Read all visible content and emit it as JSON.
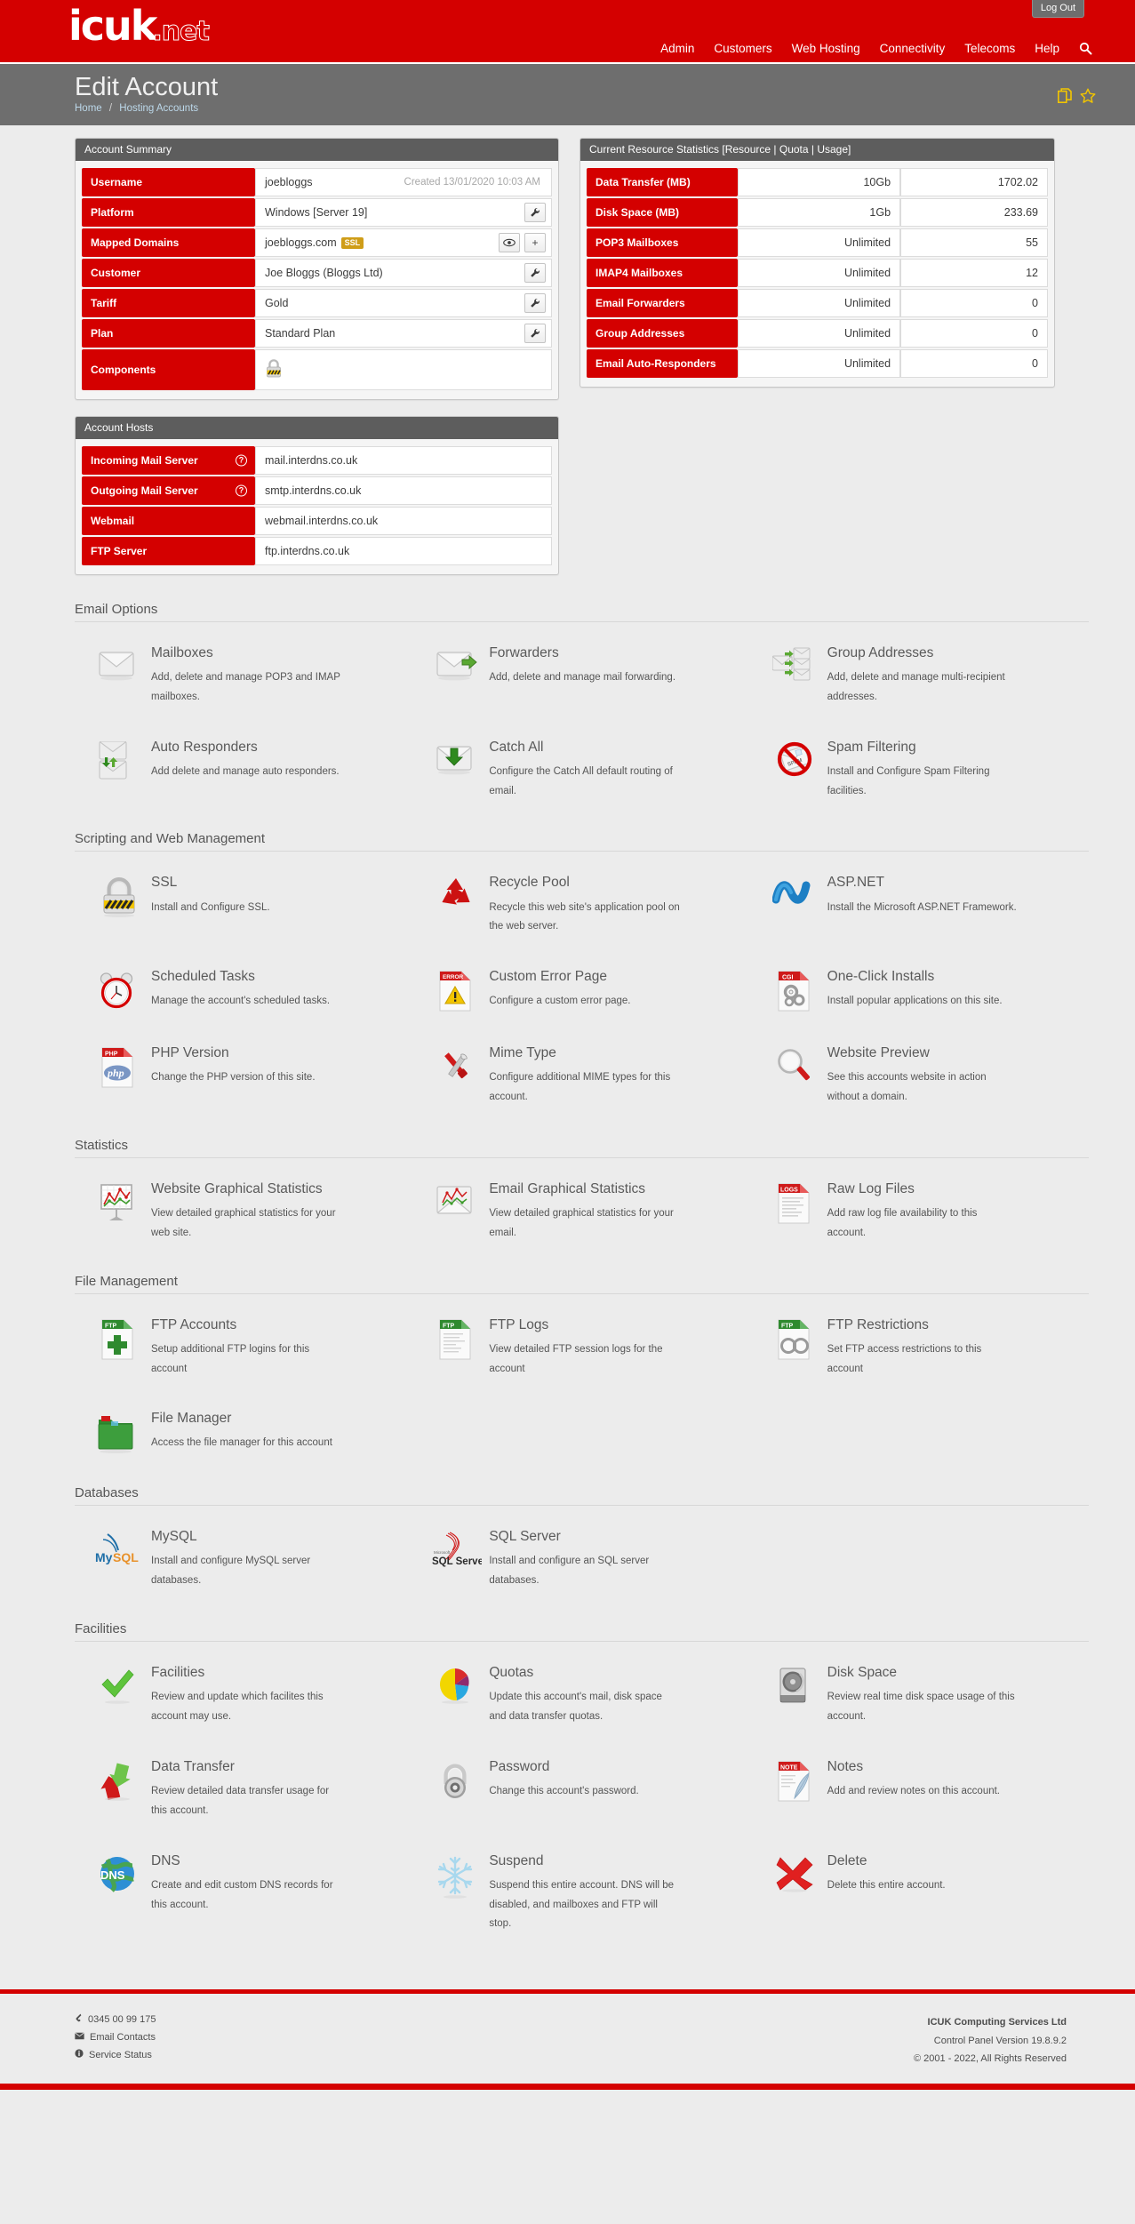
{
  "header": {
    "logo_main": "icuk",
    "logo_suffix": ".net",
    "logout_label": "Log Out",
    "nav": [
      {
        "label": "Admin"
      },
      {
        "label": "Customers"
      },
      {
        "label": "Web Hosting"
      },
      {
        "label": "Connectivity"
      },
      {
        "label": "Telecoms"
      },
      {
        "label": "Help"
      }
    ],
    "search_icon": "search-icon"
  },
  "title_band": {
    "page_title": "Edit Account",
    "breadcrumb": [
      {
        "label": "Home"
      },
      {
        "label": "Hosting Accounts"
      }
    ],
    "separator": "/",
    "actions": [
      {
        "icon": "copy-icon"
      },
      {
        "icon": "star-icon"
      }
    ]
  },
  "account_summary": {
    "panel_title": "Account Summary",
    "rows": [
      {
        "key": "Username",
        "value": "joebloggs",
        "created": "Created 13/01/2020 10:03 AM",
        "buttons": []
      },
      {
        "key": "Platform",
        "value": "Windows [Server 19]",
        "buttons": [
          "wrench"
        ]
      },
      {
        "key": "Mapped Domains",
        "value": "joebloggs.com",
        "badge": "SSL",
        "buttons": [
          "eye",
          "plus"
        ]
      },
      {
        "key": "Customer",
        "value": "Joe Bloggs (Bloggs Ltd)",
        "buttons": [
          "wrench"
        ]
      },
      {
        "key": "Tariff",
        "value": "Gold",
        "buttons": [
          "wrench"
        ]
      },
      {
        "key": "Plan",
        "value": "Standard Plan",
        "buttons": [
          "wrench"
        ]
      },
      {
        "key": "Components",
        "value": "",
        "icon": "ssl-lock-icon",
        "buttons": []
      }
    ]
  },
  "account_hosts": {
    "panel_title": "Account Hosts",
    "rows": [
      {
        "key": "Incoming Mail Server",
        "value": "mail.interdns.co.uk",
        "help": true
      },
      {
        "key": "Outgoing Mail Server",
        "value": "smtp.interdns.co.uk",
        "help": true
      },
      {
        "key": "Webmail",
        "value": "webmail.interdns.co.uk",
        "help": false
      },
      {
        "key": "FTP Server",
        "value": "ftp.interdns.co.uk",
        "help": false
      }
    ]
  },
  "resource_stats": {
    "panel_title": "Current Resource Statistics [Resource | Quota | Usage]",
    "rows": [
      {
        "resource": "Data Transfer (MB)",
        "quota": "10Gb",
        "usage": "1702.02"
      },
      {
        "resource": "Disk Space (MB)",
        "quota": "1Gb",
        "usage": "233.69"
      },
      {
        "resource": "POP3 Mailboxes",
        "quota": "Unlimited",
        "usage": "55"
      },
      {
        "resource": "IMAP4 Mailboxes",
        "quota": "Unlimited",
        "usage": "12"
      },
      {
        "resource": "Email Forwarders",
        "quota": "Unlimited",
        "usage": "0"
      },
      {
        "resource": "Group Addresses",
        "quota": "Unlimited",
        "usage": "0"
      },
      {
        "resource": "Email Auto-Responders",
        "quota": "Unlimited",
        "usage": "0"
      }
    ]
  },
  "sections": [
    {
      "id": "email-options",
      "title": "Email Options",
      "tiles": [
        {
          "icon": "envelope-icon",
          "title": "Mailboxes",
          "desc": "Add, delete and manage POP3 and IMAP mailboxes."
        },
        {
          "icon": "envelope-forward-icon",
          "title": "Forwarders",
          "desc": "Add, delete and manage mail forwarding."
        },
        {
          "icon": "envelope-group-icon",
          "title": "Group Addresses",
          "desc": "Add, delete and manage multi-recipient addresses."
        },
        {
          "icon": "envelope-autoreply-icon",
          "title": "Auto Responders",
          "desc": "Add delete and manage auto responders."
        },
        {
          "icon": "envelope-download-icon",
          "title": "Catch All",
          "desc": "Configure the Catch All default routing of email."
        },
        {
          "icon": "no-spam-icon",
          "title": "Spam Filtering",
          "desc": "Install and Configure Spam Filtering facilities."
        }
      ]
    },
    {
      "id": "scripting-web-management",
      "title": "Scripting and Web Management",
      "tiles": [
        {
          "icon": "padlock-icon",
          "title": "SSL",
          "desc": "Install and Configure SSL."
        },
        {
          "icon": "recycle-icon",
          "title": "Recycle Pool",
          "desc": "Recycle this web site's application pool on the web server."
        },
        {
          "icon": "aspnet-icon",
          "title": "ASP.NET",
          "desc": "Install the Microsoft ASP.NET Framework."
        },
        {
          "icon": "alarm-clock-icon",
          "title": "Scheduled Tasks",
          "desc": "Manage the account's scheduled tasks."
        },
        {
          "icon": "error-page-icon",
          "title": "Custom Error Page",
          "desc": "Configure a custom error page."
        },
        {
          "icon": "cgi-gears-icon",
          "title": "One-Click Installs",
          "desc": "Install popular applications on this site."
        },
        {
          "icon": "php-file-icon",
          "title": "PHP Version",
          "desc": "Change the PHP version of this site."
        },
        {
          "icon": "tools-icon",
          "title": "Mime Type",
          "desc": "Configure additional MIME types for this account."
        },
        {
          "icon": "magnifier-icon",
          "title": "Website Preview",
          "desc": "See this accounts website in action without a domain."
        }
      ]
    },
    {
      "id": "statistics",
      "title": "Statistics",
      "tiles": [
        {
          "icon": "chart-board-icon",
          "title": "Website Graphical Statistics",
          "desc": "View detailed graphical statistics for your web site."
        },
        {
          "icon": "envelope-chart-icon",
          "title": "Email Graphical Statistics",
          "desc": "View detailed graphical statistics for your email."
        },
        {
          "icon": "logs-file-icon",
          "title": "Raw Log Files",
          "desc": "Add raw log file availability to this account."
        }
      ]
    },
    {
      "id": "file-management",
      "title": "File Management",
      "tiles": [
        {
          "icon": "ftp-plus-icon",
          "title": "FTP Accounts",
          "desc": "Setup additional FTP logins for this account"
        },
        {
          "icon": "ftp-log-icon",
          "title": "FTP Logs",
          "desc": "View detailed FTP session logs for the account"
        },
        {
          "icon": "ftp-cuffs-icon",
          "title": "FTP Restrictions",
          "desc": "Set FTP access restrictions to this account"
        },
        {
          "icon": "file-manager-icon",
          "title": "File Manager",
          "desc": "Access the file manager for this account"
        }
      ]
    },
    {
      "id": "databases",
      "title": "Databases",
      "tiles": [
        {
          "icon": "mysql-icon",
          "title": "MySQL",
          "desc": "Install and configure MySQL server databases."
        },
        {
          "icon": "sqlserver-icon",
          "title": "SQL Server",
          "desc": "Install and configure an SQL server databases."
        }
      ]
    },
    {
      "id": "facilities",
      "title": "Facilities",
      "tiles": [
        {
          "icon": "green-check-icon",
          "title": "Facilities",
          "desc": "Review and update which facilites this account may use."
        },
        {
          "icon": "pie-chart-icon",
          "title": "Quotas",
          "desc": "Update this account's mail, disk space and data transfer quotas."
        },
        {
          "icon": "hard-disk-icon",
          "title": "Disk Space",
          "desc": "Review real time disk space usage of this account."
        },
        {
          "icon": "transfer-arrows-icon",
          "title": "Data Transfer",
          "desc": "Review detailed data transfer usage for this account."
        },
        {
          "icon": "combination-lock-icon",
          "title": "Password",
          "desc": "Change this account's password."
        },
        {
          "icon": "note-quill-icon",
          "title": "Notes",
          "desc": "Add and review notes on this account."
        },
        {
          "icon": "dns-globe-icon",
          "title": "DNS",
          "desc": "Create and edit custom DNS records for this account."
        },
        {
          "icon": "snowflake-icon",
          "title": "Suspend",
          "desc": "Suspend this entire account. DNS will be disabled, and mailboxes and FTP will stop."
        },
        {
          "icon": "red-cross-icon",
          "title": "Delete",
          "desc": "Delete this entire account."
        }
      ]
    }
  ],
  "footer": {
    "phone": "0345 00 99 175",
    "email_contacts": "Email Contacts",
    "service_status": "Service Status",
    "company": "ICUK Computing Services Ltd",
    "version": "Control Panel Version 19.8.9.2",
    "copyright": "© 2001 - 2022, All Rights Reserved"
  }
}
